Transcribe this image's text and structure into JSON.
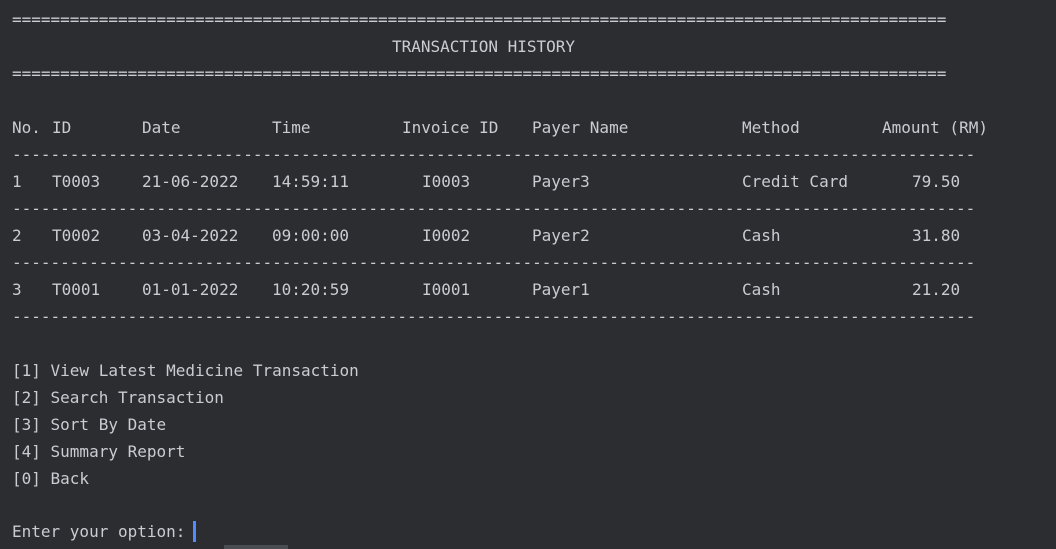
{
  "console": {
    "double_rule": "=================================================================================================",
    "single_rule": "----------------------------------------------------------------------------------------------------",
    "title": "TRANSACTION HISTORY",
    "columns": [
      "No.",
      "ID",
      "Date",
      "Time",
      "Invoice ID",
      "Payer Name",
      "Method",
      "Amount (RM)"
    ],
    "rows": [
      {
        "no": "1",
        "id": "T0003",
        "date": "21-06-2022",
        "time": "14:59:11",
        "invoice": "I0003",
        "payer": "Payer3",
        "method": "Credit Card",
        "amount": "79.50"
      },
      {
        "no": "2",
        "id": "T0002",
        "date": "03-04-2022",
        "time": "09:00:00",
        "invoice": "I0002",
        "payer": "Payer2",
        "method": "Cash",
        "amount": "31.80"
      },
      {
        "no": "3",
        "id": "T0001",
        "date": "01-01-2022",
        "time": "10:20:59",
        "invoice": "I0001",
        "payer": "Payer1",
        "method": "Cash",
        "amount": "21.20"
      }
    ],
    "menu": [
      "[1] View Latest Medicine Transaction",
      "[2] Search Transaction",
      "[3] Sort By Date",
      "[4] Summary Report",
      "[0] Back"
    ],
    "prompt": "Enter your option:"
  },
  "colors": {
    "background": "#2b2d30",
    "text": "#c9ccd1",
    "caret": "#4f8cff"
  }
}
